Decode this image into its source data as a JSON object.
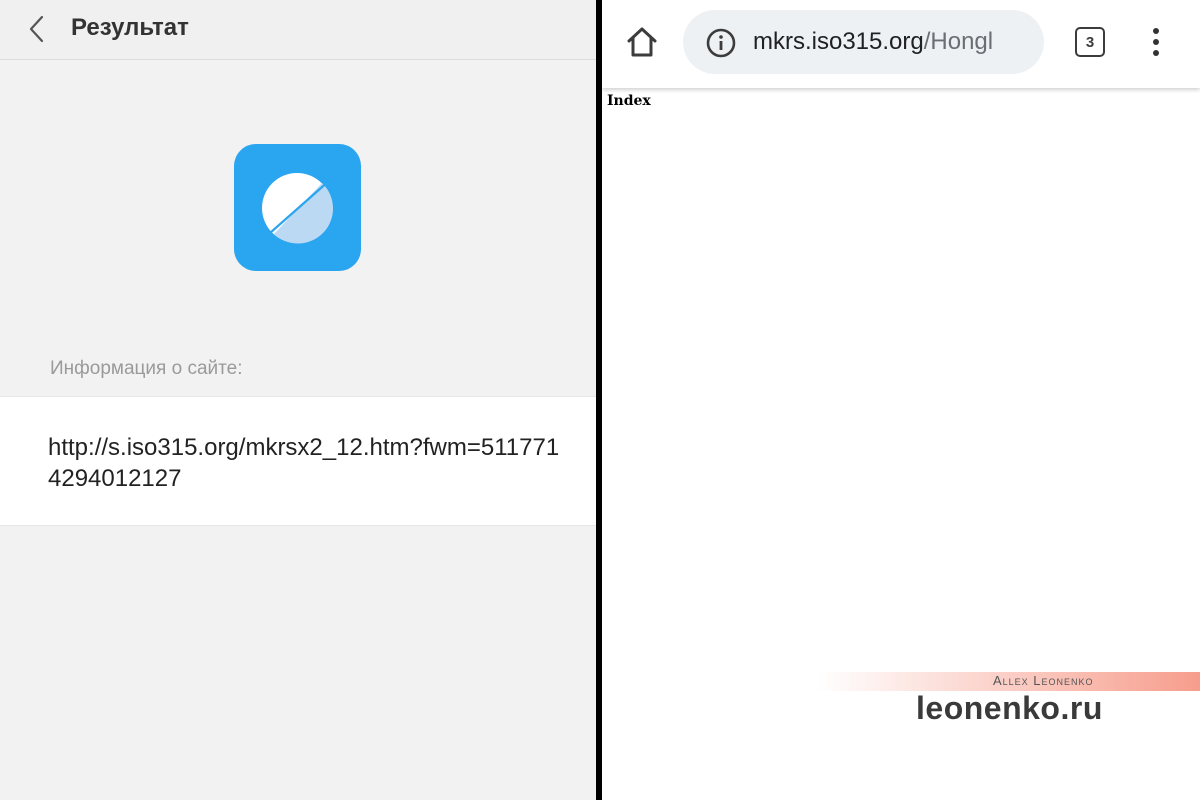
{
  "scan_result": {
    "header": {
      "title": "Результат"
    },
    "site_info_label": "Информация о сайте:",
    "url": "http://s.iso315.org/mkrsx2_12.htm?fwm=5117714294012127",
    "app_icon": "browser-planet-icon",
    "accent_color": "#2aa5ef"
  },
  "browser": {
    "url_host": "mkrs.iso315.org",
    "url_path": "/Hongl",
    "tab_count": "3",
    "page_text": "Index",
    "icons": [
      "home-icon",
      "info-icon",
      "tabs-icon",
      "more-vert-icon"
    ]
  },
  "watermark": {
    "author": "Allex Leonenko",
    "site": "leonenko.ru"
  }
}
